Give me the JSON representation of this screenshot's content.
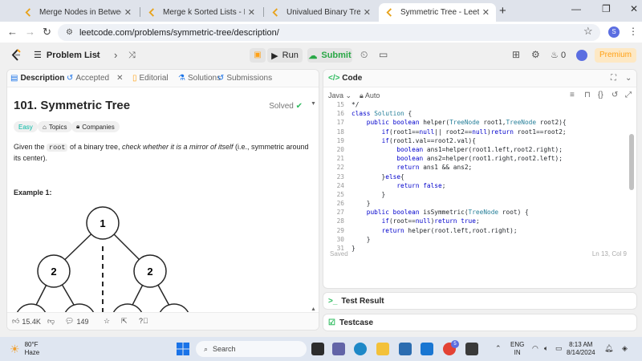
{
  "browser": {
    "tabs": [
      {
        "label": "Merge Nodes in Between Zeros",
        "active": false
      },
      {
        "label": "Merge k Sorted Lists - LeetCode",
        "active": false
      },
      {
        "label": "Univalued Binary Tree - LeetCode",
        "active": false
      },
      {
        "label": "Symmetric Tree - LeetCode",
        "active": true
      }
    ],
    "url": "leetcode.com/problems/symmetric-tree/description/",
    "profile_initial": "S"
  },
  "nav": {
    "problem_list": "Problem List",
    "run": "Run",
    "submit": "Submit",
    "streak": "0",
    "premium": "Premium"
  },
  "left": {
    "tabs": [
      "Description",
      "Accepted",
      "Editorial",
      "Solutions",
      "Submissions"
    ],
    "title": "101. Symmetric Tree",
    "solved": "Solved",
    "chips": {
      "difficulty": "Easy",
      "topics": "Topics",
      "companies": "Companies"
    },
    "desc_prefix": "Given the ",
    "desc_code": "root",
    "desc_mid": " of a binary tree, ",
    "desc_italic": "check whether it is a mirror of itself",
    "desc_suffix": " (i.e., symmetric around its center).",
    "example_label": "Example 1:",
    "tree_values": {
      "root": "1",
      "left": "2",
      "right": "2"
    },
    "likes": "15.4K",
    "comments": "149"
  },
  "code": {
    "title": "Code",
    "language": "Java",
    "mode": "Auto",
    "lines": [
      {
        "n": "15",
        "t": "*/"
      },
      {
        "n": "16",
        "t": "class Solution {"
      },
      {
        "n": "17",
        "t": "    public boolean helper(TreeNode root1,TreeNode root2){"
      },
      {
        "n": "18",
        "t": "        if(root1==null|| root2==null)return root1==root2;"
      },
      {
        "n": "19",
        "t": "        if(root1.val==root2.val){"
      },
      {
        "n": "20",
        "t": "            boolean ans1=helper(root1.left,root2.right);"
      },
      {
        "n": "21",
        "t": "            boolean ans2=helper(root1.right,root2.left);"
      },
      {
        "n": "22",
        "t": "            return ans1 && ans2;"
      },
      {
        "n": "23",
        "t": "        }else{"
      },
      {
        "n": "24",
        "t": "            return false;"
      },
      {
        "n": "25",
        "t": "        }"
      },
      {
        "n": "26",
        "t": "    }"
      },
      {
        "n": "27",
        "t": "    public boolean isSymmetric(TreeNode root) {"
      },
      {
        "n": "28",
        "t": "        if(root==null)return true;"
      },
      {
        "n": "29",
        "t": "        return helper(root.left,root.right);"
      },
      {
        "n": "30",
        "t": "    }"
      },
      {
        "n": "31",
        "t": "}"
      }
    ],
    "saved": "Saved",
    "cursor": "Ln 13, Col 9"
  },
  "test_result": "Test Result",
  "testcase": "Testcase",
  "taskbar": {
    "temp": "80°F",
    "weather": "Haze",
    "search": "Search",
    "lang_top": "ENG",
    "lang_bottom": "IN",
    "time": "8:13 AM",
    "date": "8/14/2024",
    "chrome_badge": "5"
  },
  "colors": {
    "accent": "#ffa116",
    "green": "#2cbb5d",
    "blue": "#1a73e8"
  }
}
